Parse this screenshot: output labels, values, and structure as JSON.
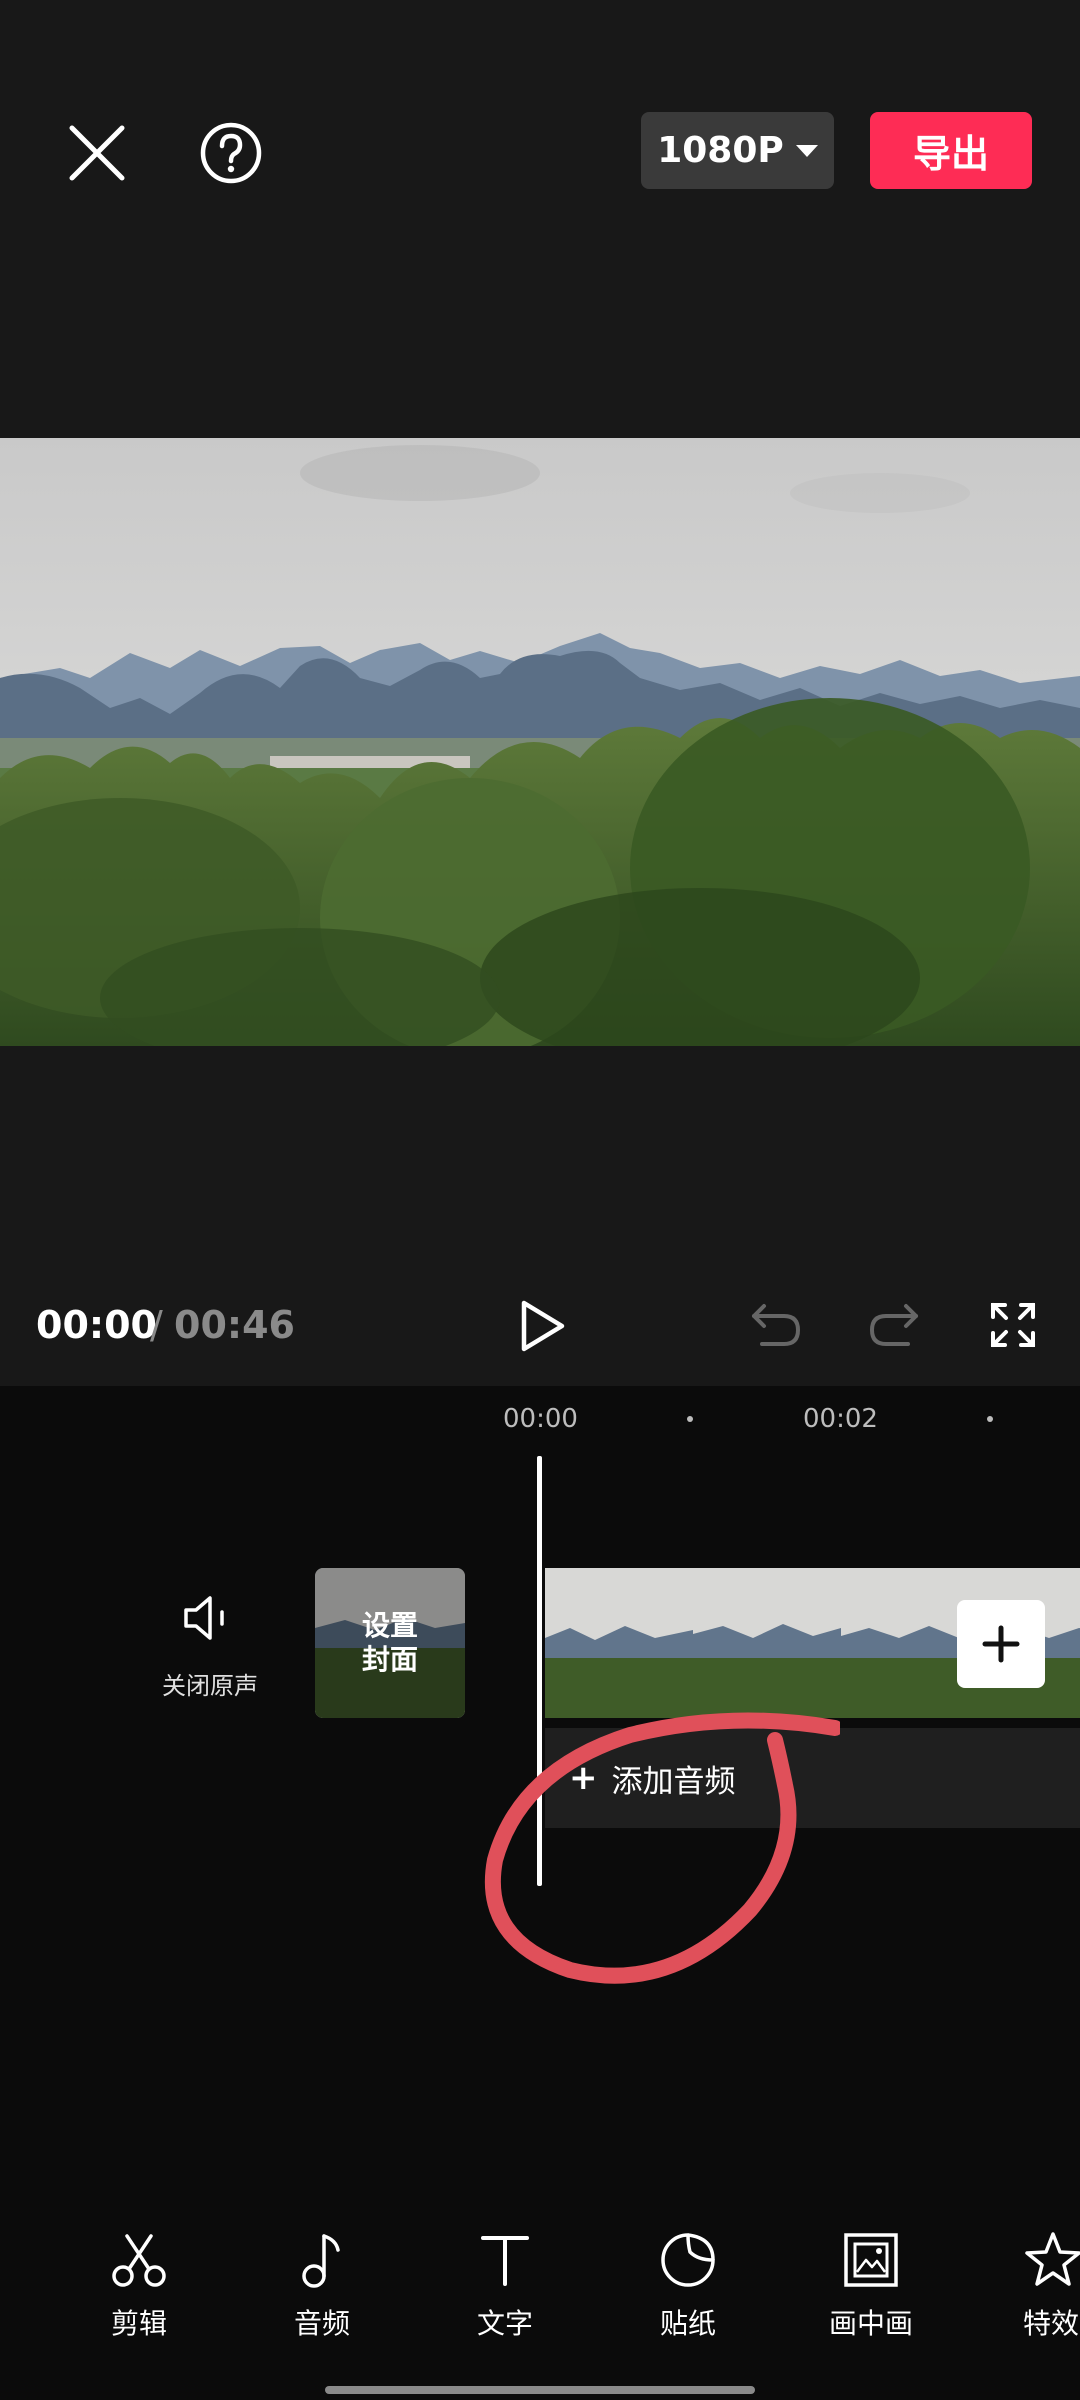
{
  "header": {
    "resolution": "1080P",
    "export_label": "导出"
  },
  "player": {
    "current_time": "00:00",
    "separator": "/",
    "total_time": "00:46"
  },
  "timeline": {
    "ruler": [
      "00:00",
      "00:02"
    ],
    "mute_label": "关闭原声",
    "cover_label_line1": "设置",
    "cover_label_line2": "封面",
    "add_audio_label": "添加音频"
  },
  "toolbar": {
    "items": [
      {
        "label": "剪辑",
        "icon": "scissors-icon"
      },
      {
        "label": "音频",
        "icon": "music-note-icon"
      },
      {
        "label": "文字",
        "icon": "text-icon"
      },
      {
        "label": "贴纸",
        "icon": "sticker-icon"
      },
      {
        "label": "画中画",
        "icon": "picture-in-picture-icon"
      },
      {
        "label": "特效",
        "icon": "effects-star-icon"
      }
    ]
  },
  "colors": {
    "accent": "#fe2c55",
    "background": "#0b0b0b",
    "panel": "#181818",
    "annotation": "#e0505a"
  }
}
